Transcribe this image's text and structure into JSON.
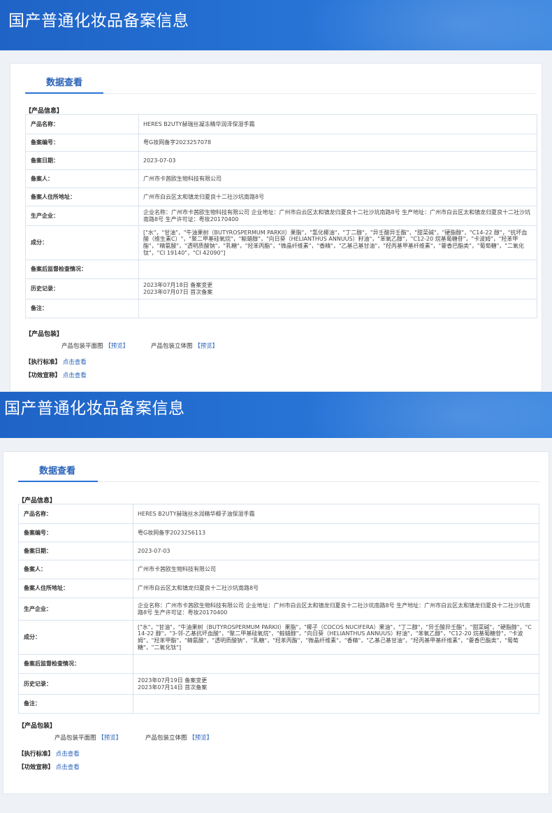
{
  "panels": [
    {
      "page_title": "国产普通化妆品备案信息",
      "tab_label": "数据查看",
      "product_info_header": "【产品信息】",
      "rows": [
        {
          "label": "产品名称：",
          "value": "HERES B2UTY赫瑞丝凝冻精华润泽保湿手霜"
        },
        {
          "label": "备案编号：",
          "value": "粤G妆网备字2023257078"
        },
        {
          "label": "备案日期：",
          "value": "2023-07-03"
        },
        {
          "label": "备案人：",
          "value": "广州市卡茜欧生物科技有限公司"
        },
        {
          "label": "备案人住所地址：",
          "value": "广州市白云区太和镇龙归夏良十二社沙坑南路8号"
        },
        {
          "label": "生产企业：",
          "value": "企业名称：广州市卡茜欧生物科技有限公司 企业地址：广州市白云区太和镇龙归夏良十二社沙坑南路8号 生产地址：广州市白云区太和镇龙归夏良十二社沙坑南路8号 生产许可证：粤妆20170400"
        },
        {
          "label": "成分：",
          "value": "[\"水\"，\"甘油\"，\"牛油果树（BUTYROSPERMUM PARKII）果脂\"，\"氢化椰油\"，\"丁二醇\"，\"异壬酸异壬酯\"，\"甜菜碱\"，\"硬脂醇\"，\"C14-22 醇\"，\"抗坏血酸（维生素C）\"，\"聚二甲基硅氧烷\"，\"鲸蜡醇\"，\"向日葵（HELIANTHUS ANNUUS）籽油\"，\"苯氧乙醇\"，\"C12-20 烷基葡糖苷\"，\"卡波姆\"，\"羟苯甲酯\"，\"精氨酸\"，\"透明质酸钠\"，\"乳糖\"，\"羟苯丙酯\"，\"微晶纤维素\"，\"香精\"，\"乙基己基甘油\"，\"羟丙基甲基纤维素\"，\"藿香巴酯类\"，\"葡萄糖\"，\"二氧化钛\"，\"CI 19140\"，\"CI 42090\"]"
        },
        {
          "label": "备案后监督检查情况：",
          "value": ""
        },
        {
          "label": "历史记录：",
          "value": "2023年07月18日 备案变更\n2023年07月07日 首次备案"
        },
        {
          "label": "备注：",
          "value": ""
        }
      ],
      "packaging_header": "【产品包装】",
      "flat_label": "产品包装平面图",
      "flat_link": "【预览】",
      "solid_label": "产品包装立体图",
      "solid_link": "【预览】",
      "standard_header": "【执行标准】",
      "standard_link": "点击查看",
      "efficacy_header": "【功效宣称】",
      "efficacy_link": "点击查看"
    },
    {
      "page_title": "国产普通化妆品备案信息",
      "tab_label": "数据查看",
      "product_info_header": "【产品信息】",
      "rows": [
        {
          "label": "产品名称：",
          "value": "HERES B2UTY赫瑞丝水润精华椰子油保湿手霜"
        },
        {
          "label": "备案编号：",
          "value": "粤G妆网备字2023256113"
        },
        {
          "label": "备案日期：",
          "value": "2023-07-03"
        },
        {
          "label": "备案人：",
          "value": "广州市卡茜欧生物科技有限公司"
        },
        {
          "label": "备案人住所地址：",
          "value": "广州市白云区太和镇龙归夏良十二社沙坑南路8号"
        },
        {
          "label": "生产企业：",
          "value": "企业名称：广州市卡茜欧生物科技有限公司 企业地址：广州市白云区太和镇龙归夏良十二社沙坑南路8号 生产地址：广州市白云区太和镇龙归夏良十二社沙坑南路8号 生产许可证：粤妆20170400"
        },
        {
          "label": "成分：",
          "value": "[\"水\"，\"甘油\"，\"牛油果树（BUTYROSPERMUM PARKII）果脂\"，\"椰子（COCOS NUCIFERA）果油\"，\"丁二醇\"，\"异壬酸异壬酯\"，\"甜菜碱\"，\"硬脂醇\"，\"C14-22 醇\"，\"3-邻-乙基抗坏血酸\"，\"聚二甲基硅氧烷\"，\"鲸蜡醇\"，\"向日葵（HELIANTHUS ANNUUS）籽油\"，\"苯氧乙醇\"，\"C12-20 烷基葡糖苷\"，\"卡波姆\"，\"羟苯甲酯\"，\"精氨酸\"，\"透明质酸钠\"，\"乳糖\"，\"羟苯丙酯\"，\"微晶纤维素\"，\"香精\"，\"乙基己基甘油\"，\"羟丙基甲基纤维素\"，\"藿香巴酯类\"，\"葡萄糖\"，\"二氧化钛\"]"
        },
        {
          "label": "备案后监督检查情况：",
          "value": ""
        },
        {
          "label": "历史记录：",
          "value": "2023年07月19日 备案变更\n2023年07月14日 首次备案"
        },
        {
          "label": "备注：",
          "value": ""
        }
      ],
      "packaging_header": "【产品包装】",
      "flat_label": "产品包装平面图",
      "flat_link": "【预览】",
      "solid_label": "产品包装立体图",
      "solid_link": "【预览】",
      "standard_header": "【执行标准】",
      "standard_link": "点击查看",
      "efficacy_header": "【功效宣称】",
      "efficacy_link": "点击查看"
    }
  ]
}
